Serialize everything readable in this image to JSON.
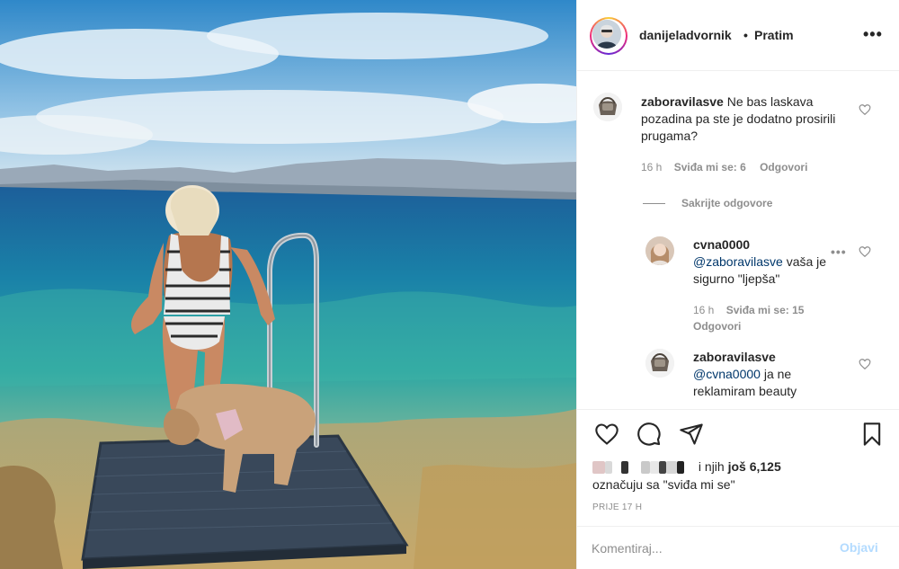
{
  "header": {
    "username": "danijeladvornik",
    "separator": "•",
    "follow_label": "Pratim",
    "more_label": "•••"
  },
  "comments": [
    {
      "username": "zaboravilasve",
      "text": "Ne bas laskava pozadina pa ste je dodatno prosirili prugama?",
      "time": "16 h",
      "likes": "Sviđa mi se: 6",
      "reply_label": "Odgovori",
      "avatar_icon": "camera-bag-avatar"
    }
  ],
  "hide_replies_label": "Sakrijte odgovore",
  "replies": [
    {
      "username": "cvna0000",
      "mention": "@zaboravilasve",
      "text_after_mention": " vaša je sigurno \"ljepša\"",
      "time": "16 h",
      "likes": "Sviđa mi se: 15",
      "reply_label": "Odgovori",
      "more_label": "•••",
      "avatar_icon": "woman-avatar"
    },
    {
      "username": "zaboravilasve",
      "mention": "@cvna0000",
      "text_after_mention": " ja ne reklamiram beauty",
      "avatar_icon": "camera-bag-avatar"
    }
  ],
  "actions": {
    "like_icon": "heart-icon",
    "comment_icon": "comment-icon",
    "share_icon": "share-icon",
    "save_icon": "bookmark-icon"
  },
  "likes": {
    "prefix": "i",
    "middle": " njih ",
    "count": "još 6,125",
    "line2": "označuju sa \"sviđa mi se\""
  },
  "time_ago": "PRIJE 17 H",
  "comment_box": {
    "placeholder": "Komentiraj...",
    "post_label": "Objavi"
  },
  "colors": {
    "text": "#262626",
    "secondary": "#8e8e8e",
    "mention": "#00376b",
    "post_disabled": "#b3dbff",
    "border": "#efefef"
  }
}
